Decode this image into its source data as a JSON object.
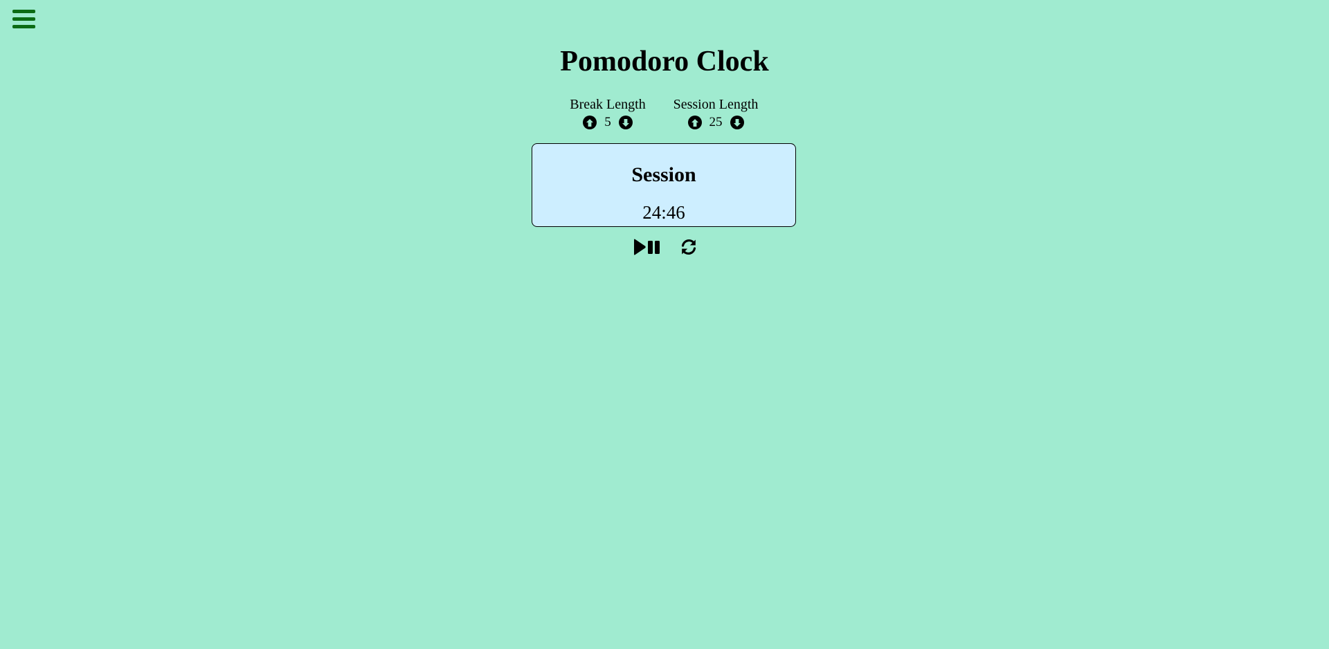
{
  "colors": {
    "background": "#a0ebd0",
    "menu_icon": "#0b6b14",
    "timer_background": "#cdeeff"
  },
  "nav": {
    "menu_icon": "hamburger-menu-icon"
  },
  "title": "Pomodoro Clock",
  "break": {
    "label": "Break Length",
    "value": "5",
    "increment_icon": "arrow-up-circle-icon",
    "decrement_icon": "arrow-down-circle-icon"
  },
  "session": {
    "label": "Session Length",
    "value": "25",
    "increment_icon": "arrow-up-circle-icon",
    "decrement_icon": "arrow-down-circle-icon"
  },
  "timer": {
    "label": "Session",
    "time_left": "24:46"
  },
  "controls": {
    "start_stop_icon": "play-pause-icon",
    "reset_icon": "refresh-icon"
  }
}
